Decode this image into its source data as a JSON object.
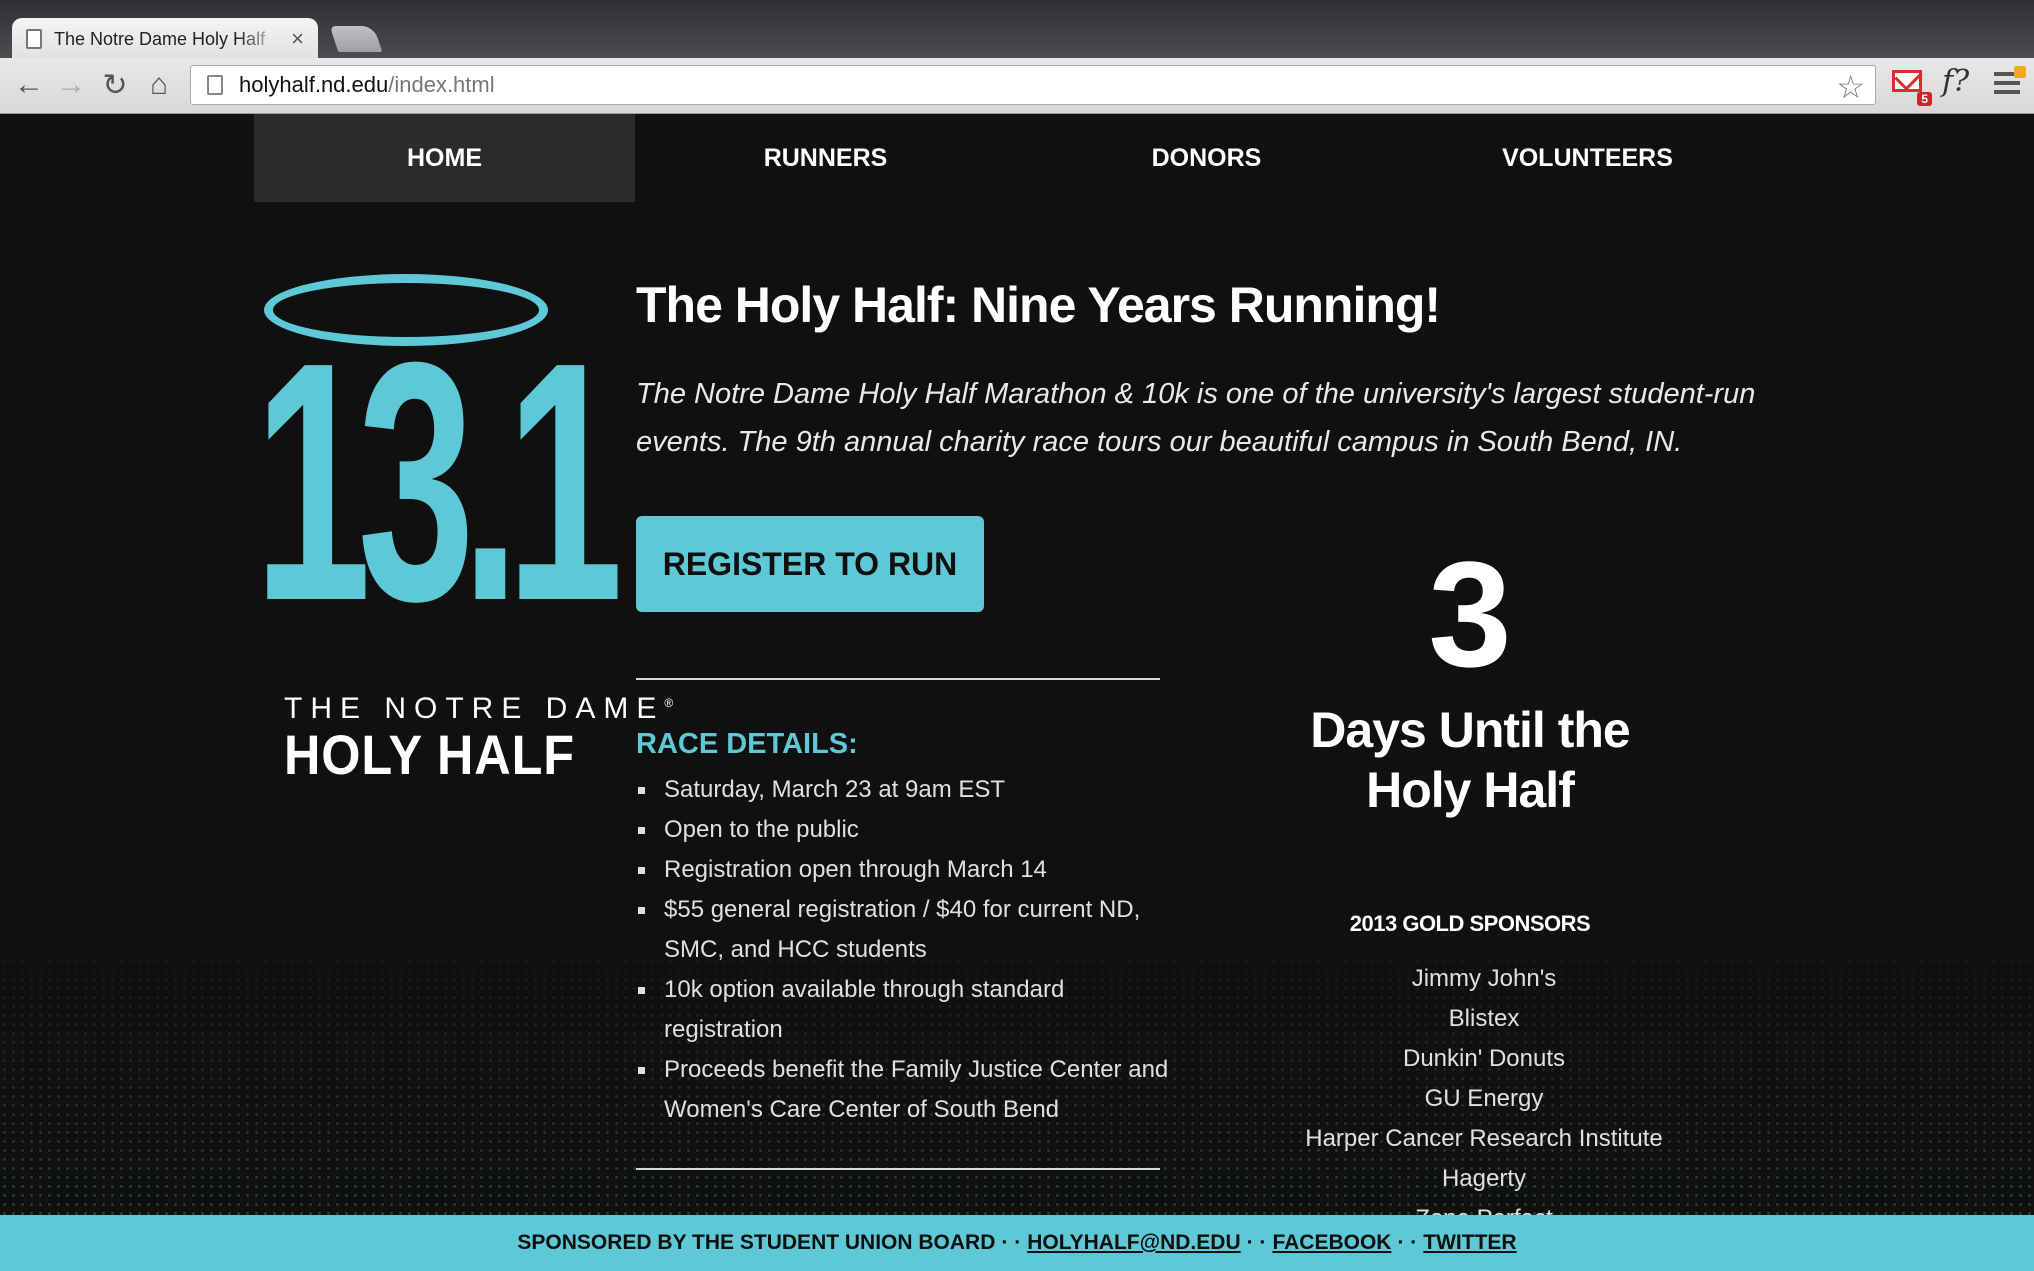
{
  "browser": {
    "tab_title": "The Notre Dame Holy Half",
    "tab_close": "×",
    "url_host": "holyhalf.nd.edu",
    "url_path": "/index.html",
    "gmail_badge": "5",
    "ext_font_label": "f?"
  },
  "nav": {
    "items": [
      {
        "label": "HOME",
        "active": true
      },
      {
        "label": "RUNNERS",
        "active": false
      },
      {
        "label": "DONORS",
        "active": false
      },
      {
        "label": "VOLUNTEERS",
        "active": false
      }
    ]
  },
  "logo": {
    "number": "13.1",
    "subtitle": "THE NOTRE DAME",
    "registered": "®",
    "title": "HOLY HALF"
  },
  "main": {
    "headline": "The Holy Half: Nine Years Running!",
    "intro": "The Notre Dame Holy Half Marathon & 10k is one of the university's largest student-run events. The 9th annual charity race tours our beautiful campus in South Bend, IN.",
    "register_label": "REGISTER TO RUN",
    "race_title": "RACE DETAILS:",
    "race_details": [
      "Saturday, March 23 at 9am EST",
      "Open to the public",
      "Registration open through March 14",
      "$55 general registration / $40 for current ND, SMC, and HCC students",
      "10k option available through standard registration",
      "Proceeds benefit the Family Justice Center and Women's Care Center of South Bend"
    ]
  },
  "countdown": {
    "days": "3",
    "label": "Days Until the Holy Half"
  },
  "sponsors": {
    "title": "2013 GOLD SPONSORS",
    "items": [
      "Jimmy John's",
      "Blistex",
      "Dunkin' Donuts",
      "GU Energy",
      "Harper Cancer Research Institute",
      "Hagerty",
      "Zone Perfect"
    ]
  },
  "footer": {
    "sponsored_by": "SPONSORED BY THE STUDENT UNION BOARD",
    "separator": "· ·",
    "email": "HOLYHALF@ND.EDU",
    "facebook": "FACEBOOK",
    "twitter": "TWITTER"
  },
  "colors": {
    "accent": "#5ec8d7",
    "background": "#101010",
    "nav_active": "#2b2b2b"
  }
}
